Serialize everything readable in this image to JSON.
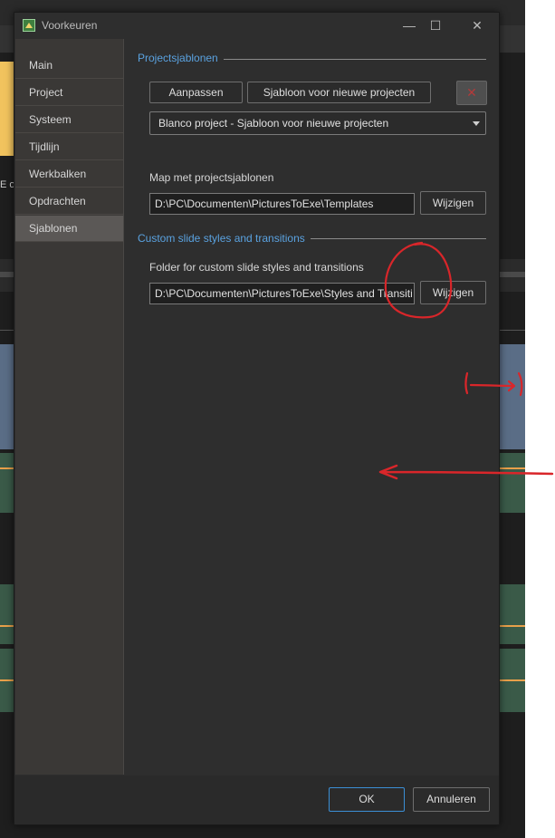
{
  "window": {
    "title": "Voorkeuren",
    "minimize_glyph": "—",
    "maximize_glyph": "☐",
    "close_glyph": "✕"
  },
  "background": {
    "fragment_text": "E o"
  },
  "sidebar": {
    "items": [
      {
        "label": "Main"
      },
      {
        "label": "Project"
      },
      {
        "label": "Systeem"
      },
      {
        "label": "Tijdlijn"
      },
      {
        "label": "Werkbalken"
      },
      {
        "label": "Opdrachten"
      },
      {
        "label": "Sjablonen",
        "active": true
      }
    ]
  },
  "templates": {
    "section_title": "Projectsjablonen",
    "customize_label": "Aanpassen",
    "new_project_template_label": "Sjabloon voor nieuwe projecten",
    "delete_glyph": "✕",
    "selected_template": "Blanco project - Sjabloon voor nieuwe projecten",
    "folder_label": "Map met projectsjablonen",
    "folder_path": "D:\\PC\\Documenten\\PicturesToExe\\Templates",
    "change_label": "Wijzigen"
  },
  "custom_styles": {
    "section_title": "Custom slide styles and transitions",
    "folder_label": "Folder for custom slide styles and transitions",
    "folder_path": "D:\\PC\\Documenten\\PicturesToExe\\Styles and Transiti",
    "change_label": "Wijzigen"
  },
  "footer": {
    "ok_label": "OK",
    "cancel_label": "Annuleren"
  },
  "colors": {
    "accent": "#5aa2e0",
    "annotation": "#d9262a"
  }
}
